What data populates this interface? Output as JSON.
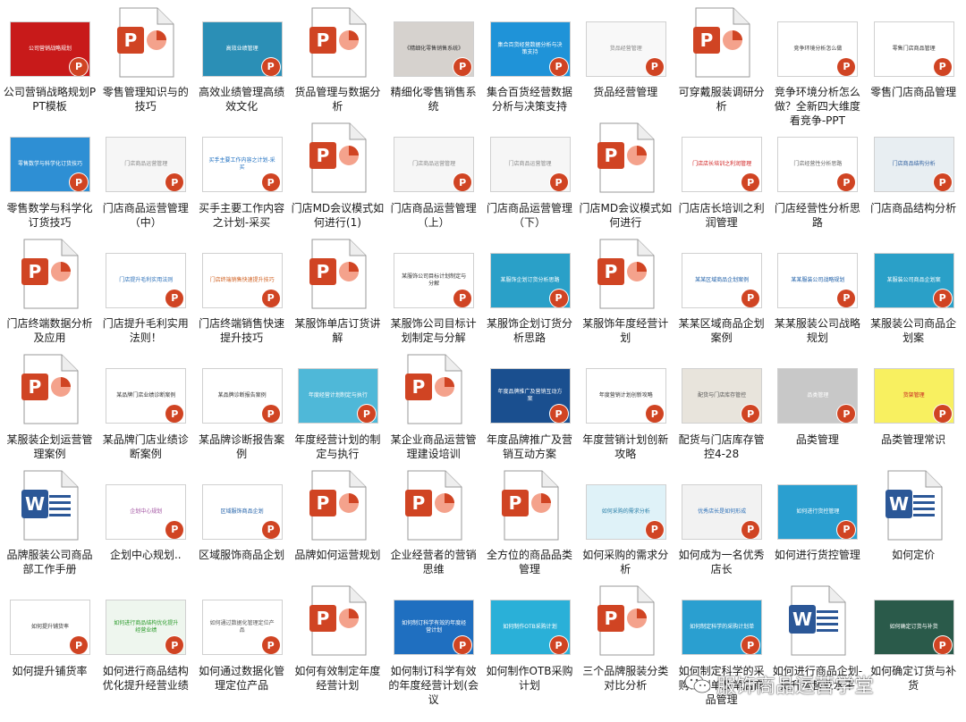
{
  "files": [
    {
      "label": "公司营销战略规划PPT模板",
      "kind": "slide",
      "bg": "#c81a1a",
      "fg": "#ffffff",
      "text": "公司营销战略规划"
    },
    {
      "label": "零售管理知识与的技巧",
      "kind": "ppt"
    },
    {
      "label": "高效业绩管理高绩效文化",
      "kind": "slide",
      "bg": "#2b8fb6",
      "fg": "#ffffff",
      "text": "高效业绩管理"
    },
    {
      "label": "货品管理与数据分析",
      "kind": "ppt"
    },
    {
      "label": "精细化零售销售系统",
      "kind": "slide",
      "bg": "#d6d2ce",
      "fg": "#333333",
      "text": "《精细化零售销售系统》"
    },
    {
      "label": "集合百货经营数据分析与决策支持",
      "kind": "slide",
      "bg": "#1f93d8",
      "fg": "#ffffff",
      "text": "集合百货经营数据分析与决策支持"
    },
    {
      "label": "货品经营管理",
      "kind": "slide",
      "bg": "#f8f8f8",
      "fg": "#888888",
      "text": "货品经营管理"
    },
    {
      "label": "可穿戴服装调研分析",
      "kind": "ppt"
    },
    {
      "label": "竞争环境分析怎么做？全新四大维度看竞争-PPT",
      "kind": "slide",
      "bg": "#ffffff",
      "fg": "#333333",
      "text": "竞争环境分析怎么做"
    },
    {
      "label": "零售门店商品管理",
      "kind": "slide",
      "bg": "#ffffff",
      "fg": "#333333",
      "text": "零售门店商品管理"
    },
    {
      "label": "零售数学与科学化订货技巧",
      "kind": "slide",
      "bg": "#2e8fd4",
      "fg": "#ffffff",
      "text": "零售数学与科学化订货技巧"
    },
    {
      "label": "门店商品运营管理（中）",
      "kind": "slide",
      "bg": "#f6f6f6",
      "fg": "#888888",
      "text": "门店商品运营管理"
    },
    {
      "label": "买手主要工作内容之计划-采买",
      "kind": "slide",
      "bg": "#ffffff",
      "fg": "#1e6fc0",
      "text": "买手主要工作内容之计划-采买"
    },
    {
      "label": "门店MD会议模式如何进行(1)",
      "kind": "ppt"
    },
    {
      "label": "门店商品运营管理（上）",
      "kind": "slide",
      "bg": "#f6f6f6",
      "fg": "#888888",
      "text": "门店商品运营管理"
    },
    {
      "label": "门店商品运营管理（下）",
      "kind": "slide",
      "bg": "#f6f6f6",
      "fg": "#888888",
      "text": "门店商品运营管理"
    },
    {
      "label": "门店MD会议模式如何进行",
      "kind": "ppt"
    },
    {
      "label": "门店店长培训之利润管理",
      "kind": "slide",
      "bg": "#ffffff",
      "fg": "#d02020",
      "text": "门店店长培训之利润管理"
    },
    {
      "label": "门店经营性分析思路",
      "kind": "slide",
      "bg": "#ffffff",
      "fg": "#666666",
      "text": "门店经营性分析思路"
    },
    {
      "label": "门店商品结构分析",
      "kind": "slide",
      "bg": "#e8eef2",
      "fg": "#3060a0",
      "text": "门店商品结构分析"
    },
    {
      "label": "门店终端数据分析及应用",
      "kind": "ppt"
    },
    {
      "label": "门店提升毛利实用法则！",
      "kind": "slide",
      "bg": "#ffffff",
      "fg": "#2a6fb8",
      "text": "门店提升毛利实用法则"
    },
    {
      "label": "门店终端销售快速提升技巧",
      "kind": "slide",
      "bg": "#ffffff",
      "fg": "#d06020",
      "text": "门店终端销售快速提升技巧"
    },
    {
      "label": "某服饰单店订货讲解",
      "kind": "ppt"
    },
    {
      "label": "某服饰公司目标计划制定与分解",
      "kind": "slide",
      "bg": "#ffffff",
      "fg": "#333333",
      "text": "某服饰公司目标计划制定与分解"
    },
    {
      "label": "某服饰企划订货分析思路",
      "kind": "slide",
      "bg": "#2aa0c8",
      "fg": "#ffffff",
      "text": "某服饰企划订货分析思路"
    },
    {
      "label": "某服饰年度经营计划",
      "kind": "ppt"
    },
    {
      "label": "某某区域商品企划案例",
      "kind": "slide",
      "bg": "#ffffff",
      "fg": "#1e5fa8",
      "text": "某某区域商品企划案例"
    },
    {
      "label": "某某服装公司战略规划",
      "kind": "slide",
      "bg": "#ffffff",
      "fg": "#1e5fa8",
      "text": "某某服装公司战略规划"
    },
    {
      "label": "某服装公司商品企划案",
      "kind": "slide",
      "bg": "#2aa0c8",
      "fg": "#ffffff",
      "text": "某服装公司商品企划案"
    },
    {
      "label": "某服装企划运营管理案例",
      "kind": "ppt"
    },
    {
      "label": "某品牌门店业绩诊断案例",
      "kind": "slide",
      "bg": "#ffffff",
      "fg": "#333333",
      "text": "某品牌门店业绩诊断案例"
    },
    {
      "label": "某品牌诊断报告案例",
      "kind": "slide",
      "bg": "#ffffff",
      "fg": "#333333",
      "text": "某品牌诊断报告案例"
    },
    {
      "label": "年度经营计划的制定与执行",
      "kind": "slide",
      "bg": "#4fb8d8",
      "fg": "#ffffff",
      "text": "年度经营计划制定与执行"
    },
    {
      "label": "某企业商品运营管理建设培训",
      "kind": "ppt"
    },
    {
      "label": "年度品牌推广及营销互动方案",
      "kind": "slide",
      "bg": "#1a4f8f",
      "fg": "#ffffff",
      "text": "年度品牌推广及营销互动方案"
    },
    {
      "label": "年度营销计划创新攻略",
      "kind": "slide",
      "bg": "#ffffff",
      "fg": "#333333",
      "text": "年度营销计划创新攻略"
    },
    {
      "label": "配货与门店库存管控4-28",
      "kind": "slide",
      "bg": "#e8e4dc",
      "fg": "#555555",
      "text": "配货与门店库存管控"
    },
    {
      "label": "品类管理",
      "kind": "slide",
      "bg": "#c8c8c8",
      "fg": "#ffffff",
      "text": "品类管理"
    },
    {
      "label": "品类管理常识",
      "kind": "slide",
      "bg": "#f8f060",
      "fg": "#c82020",
      "text": "货架管理"
    },
    {
      "label": "品牌服装公司商品部工作手册",
      "kind": "word"
    },
    {
      "label": "企划中心规划..",
      "kind": "slide",
      "bg": "#ffffff",
      "fg": "#a050a0",
      "text": "企划中心规划"
    },
    {
      "label": "区域服饰商品企划",
      "kind": "slide",
      "bg": "#ffffff",
      "fg": "#1e5fa8",
      "text": "区域服饰商品企划"
    },
    {
      "label": "品牌如何运营规划",
      "kind": "ppt"
    },
    {
      "label": "企业经营者的营销思维",
      "kind": "ppt"
    },
    {
      "label": "全方位的商品品类管理",
      "kind": "ppt"
    },
    {
      "label": "如何采购的需求分析",
      "kind": "slide",
      "bg": "#dff2f8",
      "fg": "#2a7fa8",
      "text": "如何采购的需求分析"
    },
    {
      "label": "如何成为一名优秀店长",
      "kind": "slide",
      "bg": "#f2f2f2",
      "fg": "#2a6fb8",
      "text": "优秀店长是如何形成"
    },
    {
      "label": "如何进行货控管理",
      "kind": "slide",
      "bg": "#2a9fd0",
      "fg": "#ffffff",
      "text": "如何进行货控管理"
    },
    {
      "label": "如何定价",
      "kind": "word"
    },
    {
      "label": "如何提升铺货率",
      "kind": "slide",
      "bg": "#ffffff",
      "fg": "#333333",
      "text": "如何提升铺货率"
    },
    {
      "label": "如何进行商品结构优化提升经营业绩",
      "kind": "slide",
      "bg": "#eef6ee",
      "fg": "#2a9a2a",
      "text": "如何进行商品结构优化提升经营业绩"
    },
    {
      "label": "如何通过数据化管理定位产品",
      "kind": "slide",
      "bg": "#ffffff",
      "fg": "#555555",
      "text": "如何通过数据化管理定位产品"
    },
    {
      "label": "如何有效制定年度经营计划",
      "kind": "ppt"
    },
    {
      "label": "如何制订科学有效的年度经营计划(会议",
      "kind": "slide",
      "bg": "#1f6fc0",
      "fg": "#ffffff",
      "text": "如何制订科学有效的年度经营计划"
    },
    {
      "label": "如何制作OTB采购计划",
      "kind": "slide",
      "bg": "#2ab0d8",
      "fg": "#ffffff",
      "text": "如何制作OTB采购计划"
    },
    {
      "label": "三个品牌服装分类对比分析",
      "kind": "ppt"
    },
    {
      "label": "如何制定科学的采购计划单及单店商品管理",
      "kind": "slide",
      "bg": "#2a9fd0",
      "fg": "#ffffff",
      "text": "如何制定科学的采购计划单"
    },
    {
      "label": "如何进行商品企划-提升零售业水平",
      "kind": "word"
    },
    {
      "label": "如何确定订货与补货",
      "kind": "slide",
      "bg": "#2a5a4a",
      "fg": "#ffffff",
      "text": "如何确定订货与补货"
    }
  ],
  "watermark": {
    "text": "服饰商品运营学堂"
  },
  "icons": {
    "ppt_badge": "P",
    "word_badge": "W"
  },
  "colors": {
    "ppt_red": "#d04423",
    "word_blue": "#2b5797"
  }
}
